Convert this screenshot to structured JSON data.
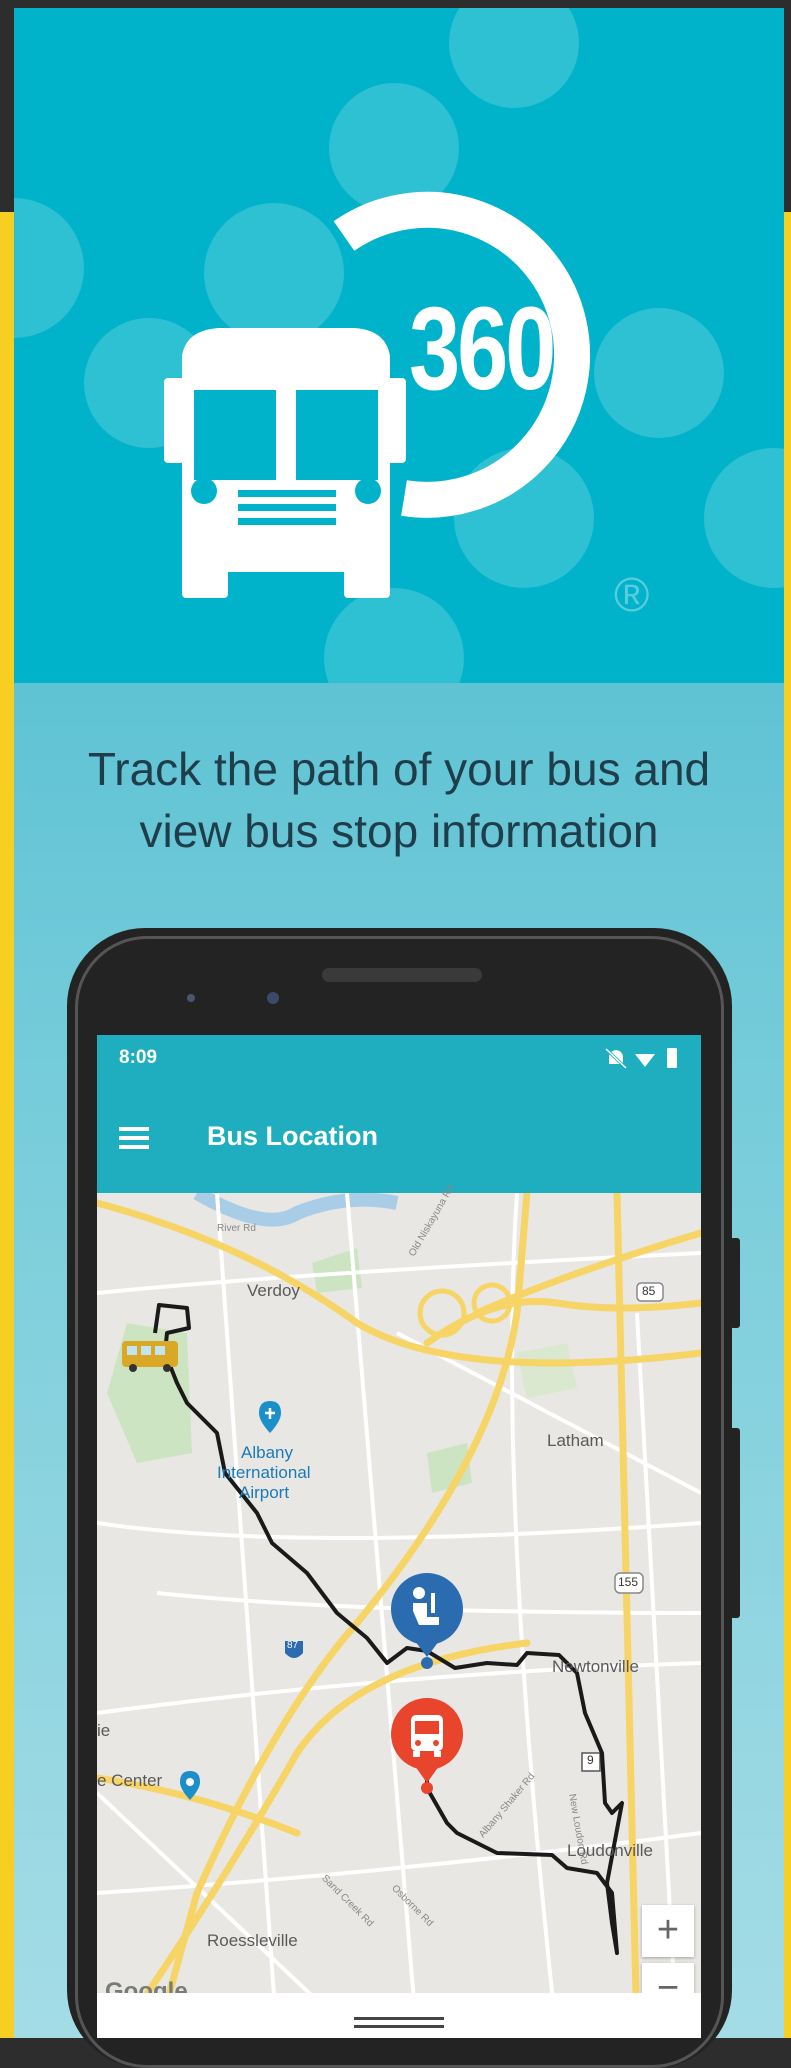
{
  "banner": {
    "logo_number": "360",
    "registered_mark": "®"
  },
  "tagline": {
    "line1": "Track the path of your bus and",
    "line2": "view bus stop information"
  },
  "phone": {
    "status_time": "8:09",
    "app_title": "Bus Location"
  },
  "map": {
    "labels": {
      "verdoy": "Verdoy",
      "albany1": "Albany",
      "albany2": "International",
      "albany3": "Airport",
      "latham": "Latham",
      "newtonville": "Newtonville",
      "loudonville": "Loudonville",
      "roessleville": "Roessleville",
      "center": "e Center",
      "edge_ie": "ie",
      "route_9": "9",
      "route_155": "155",
      "route_85": "85",
      "i87": "87",
      "river_rd": "River Rd",
      "old_niskayuna": "Old Niskayuna Rd",
      "new_loudon": "New Loudon Rd",
      "sand_creek": "Sand Creek Rd",
      "osborne": "Osborne Rd",
      "albany_shaker": "Albany Shaker Rd"
    },
    "zoom_in": "+",
    "zoom_out": "−",
    "attribution": "Google"
  },
  "colors": {
    "banner": "#00b2ca",
    "frame": "#f7cf22",
    "app_bar": "#1faec0",
    "stop_marker": "#2b6cb0",
    "bus_marker": "#e8452c",
    "route": "#1a1a1a"
  },
  "icons": {
    "menu": "hamburger-icon",
    "wifi": "wifi-icon",
    "battery": "battery-icon",
    "mute": "notifications-off-icon",
    "stop": "bus-stop-person-icon",
    "bus": "bus-icon",
    "airport": "airport-pin-icon"
  }
}
